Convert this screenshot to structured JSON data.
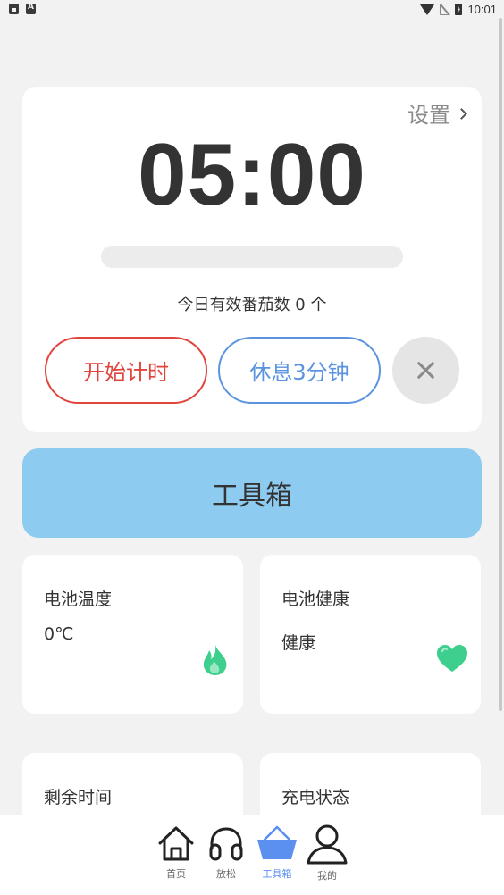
{
  "status_bar": {
    "time": "10:01",
    "left_icons": [
      "lock-icon",
      "a-badge-icon"
    ],
    "right_icons": [
      "wifi-icon",
      "no-sim-icon",
      "battery-charging-icon"
    ]
  },
  "timer": {
    "settings_label": "设置",
    "time": "05:00",
    "progress": 0,
    "daily_count": "今日有效番茄数 0 个",
    "start_button": "开始计时",
    "rest_button": "休息3分钟",
    "close_icon": "close-icon",
    "colors": {
      "start": "#e0443d",
      "rest": "#5b93e0"
    }
  },
  "toolbox": {
    "label": "工具箱",
    "color": "#8ecbf0"
  },
  "cards": [
    {
      "title": "电池温度",
      "value": "0℃",
      "icon": "flame-icon"
    },
    {
      "title": "电池健康",
      "value": "健康",
      "icon": "heart-icon"
    },
    {
      "title": "剩余时间",
      "value": "",
      "icon": ""
    },
    {
      "title": "充电状态",
      "value": "",
      "icon": ""
    }
  ],
  "bottom_nav": {
    "items": [
      {
        "label": "首页",
        "icon": "home-icon"
      },
      {
        "label": "放松",
        "icon": "headphones-icon"
      },
      {
        "label": "工具箱",
        "icon": "basket-icon",
        "active": true
      },
      {
        "label": "我的",
        "icon": "profile-icon"
      }
    ],
    "active_color": "#5b8ff0"
  }
}
